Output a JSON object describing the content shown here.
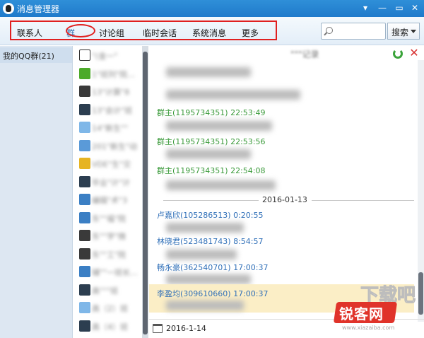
{
  "window": {
    "title": "消息管理器",
    "controls": [
      "▾",
      "—",
      "▭",
      "✕"
    ]
  },
  "toolbar": {
    "tabs": [
      "联系人",
      "群",
      "讨论组",
      "临时会话",
      "系统消息",
      "更多"
    ],
    "active_tab": "群",
    "search_placeholder": "",
    "search_button": "搜索"
  },
  "sidebar": {
    "items": [
      {
        "label": "我的QQ群(21)"
      }
    ]
  },
  "group_list": {
    "rows": [
      {
        "name": "\"(金一\"",
        "icon": "qq-group-icon",
        "blurred": true
      },
      {
        "name": "1\"班列\"院…",
        "icon": "green-5-icon",
        "blurred": true
      },
      {
        "name": "13\"计算\"8",
        "icon": "dark-logo-icon",
        "blurred": true
      },
      {
        "name": "13\"会计\"班",
        "icon": "graduation-cap-icon",
        "blurred": true
      },
      {
        "name": "14\"新生\"\"",
        "icon": "people-icon",
        "blurred": true
      },
      {
        "name": "201\"新生\"动",
        "icon": "robot-icon",
        "blurred": true
      },
      {
        "name": "VDE\"生\"交",
        "icon": "badge-icon",
        "blurred": true
      },
      {
        "name": "毕业\"计\"计",
        "icon": "graduation-cap-icon",
        "blurred": true
      },
      {
        "name": "编辑\"术\"3",
        "icon": "puzzle-icon",
        "blurred": true
      },
      {
        "name": "东\"\"福\"院",
        "icon": "puzzle-icon",
        "blurred": true
      },
      {
        "name": "东\"\"学\"微",
        "icon": "dark-logo-icon",
        "blurred": true
      },
      {
        "name": "东\"\"工\"院",
        "icon": "dark-logo-icon",
        "blurred": true
      },
      {
        "name": "辅\"\"一班长…",
        "icon": "puzzle-icon",
        "blurred": true
      },
      {
        "name": "高\"\"\"班",
        "icon": "graduation-cap-icon",
        "blurred": true
      },
      {
        "name": "高（2）班",
        "icon": "people-icon",
        "blurred": true
      },
      {
        "name": "高（4）班",
        "icon": "graduation-cap-icon",
        "blurred": true
      }
    ]
  },
  "messages": {
    "header_title": "\"\"\"记录",
    "date_separator": "2016-01-13",
    "entries": [
      {
        "sender": "群主(1195734351) 22:53:49",
        "color": "green"
      },
      {
        "sender": "群主(1195734351) 22:53:56",
        "color": "green"
      },
      {
        "sender": "群主(1195734351) 22:54:08",
        "color": "green"
      },
      {
        "sender": "卢嘉欣(105286513) 0:20:55",
        "color": "blue"
      },
      {
        "sender": "林晓君(523481743) 8:54:57",
        "color": "blue"
      },
      {
        "sender": "畅永豪(362540701) 17:00:37",
        "color": "blue"
      },
      {
        "sender": "李盈均(309610660) 17:00:37",
        "color": "blue"
      }
    ],
    "footer_date": "2016-1-14"
  },
  "watermark": {
    "brand": "锐客网",
    "top_mark": "下载吧",
    "url": "www.xiazaiba.com"
  },
  "colors": {
    "titlebar": "#1f7acb",
    "annotation_red": "#e02020",
    "sender_green": "#3a9a3a",
    "sender_blue": "#2f6fb8",
    "highlight": "#fbeec6"
  }
}
